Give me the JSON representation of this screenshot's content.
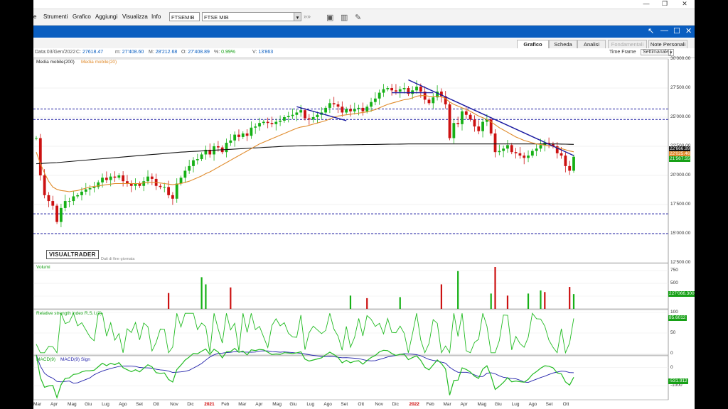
{
  "window": {
    "minimize_icon": "—",
    "restore_icon": "❐",
    "close_icon": "✕"
  },
  "menu": {
    "items": [
      "e",
      "Strumenti",
      "Grafico",
      "Aggiungi",
      "Visualizza",
      "Info"
    ]
  },
  "toolbar": {
    "symbol_code": "FTSEMIB",
    "symbol_name": "FTSE MIB",
    "go_icon": "»»"
  },
  "panel_controls": {
    "pin_icon": "↖",
    "min_icon": "—",
    "max_icon": "☐",
    "close_icon": "✕"
  },
  "tabs": [
    {
      "label": "Grafico",
      "active": true
    },
    {
      "label": "Scheda"
    },
    {
      "label": "Analisi"
    },
    {
      "label": "Fondamentali",
      "disabled": true
    },
    {
      "label": "Note Personali"
    }
  ],
  "timeframe": {
    "label": "Time Frame",
    "value": "Settimanale"
  },
  "ohlc": {
    "date_label": "Data:",
    "date": "03/Gen/2022",
    "c_label": "C:",
    "c": "27618.47",
    "m_label": "m:",
    "m": "27'408.60",
    "M_label": "M:",
    "M": "28'212.68",
    "O_label": "O:",
    "O": "27'408.89",
    "pct_label": "%:",
    "pct": "0.99%",
    "v_label": "V:",
    "v": "13'863"
  },
  "indicators": {
    "ma200": "Media mobile(200)",
    "ma20": "Media mobile(20)",
    "volume": "Volumi",
    "rsi": "Relative strength index R.S.I.(2)",
    "macd": "MACD(9)",
    "macd_sign": "MACD(9) Sign"
  },
  "brand": {
    "logo": "VISUALTRADER",
    "note": "Dati di fine giornata"
  },
  "price_axis": [
    "30'000.00",
    "27'500.00",
    "25'000.00",
    "22'500.00",
    "20'000.00",
    "17'500.00",
    "15'000.00",
    "12'500.00"
  ],
  "price_tags": {
    "ma200": "22'666.99",
    "ma20": "22'025.46",
    "last": "21'567.55"
  },
  "volume_axis": [
    "750",
    "500",
    "250"
  ],
  "volume_tag": "227'066.300",
  "rsi_axis": [
    "100",
    "50",
    "0"
  ],
  "rsi_tag": "85.6012",
  "macd_axis": [
    "0",
    "-1000"
  ],
  "macd_tag": "-531.912",
  "x_labels": [
    {
      "t": "Mar"
    },
    {
      "t": "Apr"
    },
    {
      "t": "Mag"
    },
    {
      "t": "Giu"
    },
    {
      "t": "Lug"
    },
    {
      "t": "Ago"
    },
    {
      "t": "Set"
    },
    {
      "t": "Ott"
    },
    {
      "t": "Nov"
    },
    {
      "t": "Dic"
    },
    {
      "t": "2021",
      "year": true
    },
    {
      "t": "Feb"
    },
    {
      "t": "Mar"
    },
    {
      "t": "Apr"
    },
    {
      "t": "Mag"
    },
    {
      "t": "Giu"
    },
    {
      "t": "Lug"
    },
    {
      "t": "Ago"
    },
    {
      "t": "Set"
    },
    {
      "t": "Ott"
    },
    {
      "t": "Nov"
    },
    {
      "t": "Dic"
    },
    {
      "t": "2022",
      "year": true
    },
    {
      "t": "Feb"
    },
    {
      "t": "Mar"
    },
    {
      "t": "Apr"
    },
    {
      "t": "Mag"
    },
    {
      "t": "Giu"
    },
    {
      "t": "Lug"
    },
    {
      "t": "Ago"
    },
    {
      "t": "Set"
    },
    {
      "t": "Ott"
    }
  ],
  "colors": {
    "up": "#16b016",
    "down": "#cc1111",
    "ma20": "#e08a2a",
    "ma200": "#111111",
    "hline": "#1a1aa0",
    "trend": "#1a1aa0",
    "rsi": "#22bb22",
    "macd": "#22bb22",
    "signal": "#2222aa",
    "accent": "#0a5ec0"
  },
  "chart_data": {
    "type": "candlestick",
    "frequency": "weekly",
    "ylim": [
      12500,
      30000
    ],
    "close": [
      23200,
      20000,
      18300,
      17800,
      17400,
      16000,
      17200,
      17800,
      17800,
      18200,
      18300,
      18600,
      18800,
      18900,
      19000,
      19400,
      19800,
      19600,
      19900,
      19800,
      20000,
      19500,
      19300,
      19100,
      19300,
      19100,
      19500,
      19900,
      19700,
      19100,
      19000,
      19000,
      18300,
      18000,
      19300,
      19800,
      20400,
      20800,
      21300,
      21400,
      21800,
      22200,
      21800,
      22500,
      22400,
      22000,
      22800,
      23000,
      23500,
      23300,
      23600,
      23400,
      24100,
      24200,
      24500,
      24600,
      24500,
      24400,
      24600,
      24700,
      25000,
      25100,
      25200,
      25400,
      25600,
      24900,
      24800,
      25000,
      25200,
      25400,
      25800,
      26200,
      26100,
      25900,
      25400,
      25700,
      25500,
      25700,
      25800,
      25500,
      25900,
      26300,
      26600,
      27100,
      27400,
      27500,
      27300,
      27200,
      27400,
      27500,
      27000,
      27300,
      27618,
      27200,
      26500,
      26200,
      26700,
      27200,
      26800,
      26100,
      23200,
      24500,
      24400,
      25500,
      25200,
      24800,
      24200,
      23800,
      24600,
      24800,
      23600,
      22000,
      22100,
      22300,
      22600,
      22000,
      21900,
      21700,
      21500,
      21700,
      22100,
      22300,
      22600,
      22800,
      22700,
      22500,
      21900,
      21700,
      20800,
      20400,
      21600
    ],
    "ma20": [
      22000,
      21000,
      20200,
      19500,
      19000,
      18800,
      18700,
      18650,
      18600,
      18650,
      18700,
      18800,
      18900,
      19000,
      19050,
      19100,
      19150,
      19200,
      19250,
      19300,
      19300,
      19300,
      19300,
      19300,
      19300,
      19300,
      19350,
      19400,
      19400,
      19380,
      19350,
      19300,
      19250,
      19200,
      19250,
      19300,
      19400,
      19500,
      19650,
      19800,
      19950,
      20150,
      20300,
      20500,
      20700,
      20900,
      21100,
      21300,
      21500,
      21700,
      21900,
      22100,
      22300,
      22500,
      22700,
      22850,
      23000,
      23150,
      23300,
      23450,
      23600,
      23750,
      23900,
      24050,
      24150,
      24200,
      24300,
      24400,
      24500,
      24600,
      24700,
      24850,
      25000,
      25100,
      25150,
      25200,
      25250,
      25300,
      25350,
      25400,
      25450,
      25550,
      25650,
      25800,
      25950,
      26100,
      26200,
      26300,
      26400,
      26500,
      26550,
      26650,
      26800,
      26850,
      26850,
      26800,
      26800,
      26800,
      26750,
      26600,
      26300,
      26100,
      25950,
      25800,
      25650,
      25500,
      25300,
      25100,
      24950,
      24800,
      24600,
      24350,
      24100,
      23900,
      23700,
      23500,
      23300,
      23150,
      23000,
      22900,
      22800,
      22700,
      22650,
      22600,
      22550,
      22500,
      22400,
      22300,
      22200,
      22100,
      22025
    ],
    "ma200": [
      21000,
      21020,
      21040,
      21060,
      21080,
      21100,
      21130,
      21160,
      21190,
      21220,
      21250,
      21280,
      21310,
      21340,
      21370,
      21400,
      21430,
      21460,
      21490,
      21520,
      21550,
      21580,
      21610,
      21640,
      21670,
      21700,
      21730,
      21760,
      21790,
      21820,
      21850,
      21880,
      21910,
      21940,
      21970,
      22000,
      22020,
      22040,
      22060,
      22080,
      22100,
      22120,
      22140,
      22160,
      22180,
      22200,
      22220,
      22240,
      22260,
      22280,
      22300,
      22320,
      22340,
      22360,
      22380,
      22400,
      22420,
      22440,
      22460,
      22480,
      22500,
      22510,
      22520,
      22530,
      22540,
      22550,
      22560,
      22570,
      22580,
      22590,
      22600,
      22605,
      22610,
      22615,
      22620,
      22625,
      22630,
      22635,
      22640,
      22645,
      22650,
      22655,
      22660,
      22665,
      22670,
      22675,
      22680,
      22685,
      22690,
      22695,
      22700,
      22700,
      22700,
      22700,
      22700,
      22700,
      22700,
      22700,
      22700,
      22700,
      22700,
      22700,
      22700,
      22700,
      22700,
      22700,
      22700,
      22700,
      22700,
      22700,
      22700,
      22700,
      22700,
      22700,
      22700,
      22700,
      22700,
      22700,
      22700,
      22700,
      22700,
      22700,
      22700,
      22700,
      22700,
      22700,
      22700,
      22690,
      22680,
      22670,
      22667
    ],
    "horizontal_levels": [
      25700,
      24800,
      16700,
      15000
    ],
    "trendlines": [
      {
        "from": {
          "i": 63,
          "v": 25900
        },
        "to": {
          "i": 75,
          "v": 24700
        }
      },
      {
        "from": {
          "i": 90,
          "v": 28200
        },
        "to": {
          "i": 130,
          "v": 21700
        }
      },
      {
        "from": {
          "i": 86,
          "v": 27100
        },
        "to": {
          "i": 96,
          "v": 27100
        }
      }
    ],
    "volume_spikes": [
      {
        "i": 32,
        "v": 310,
        "dir": "down"
      },
      {
        "i": 40,
        "v": 620,
        "dir": "up"
      },
      {
        "i": 41,
        "v": 480,
        "dir": "up"
      },
      {
        "i": 47,
        "v": 420,
        "dir": "down"
      },
      {
        "i": 76,
        "v": 260,
        "dir": "up"
      },
      {
        "i": 80,
        "v": 210,
        "dir": "down"
      },
      {
        "i": 88,
        "v": 230,
        "dir": "up"
      },
      {
        "i": 98,
        "v": 480,
        "dir": "down"
      },
      {
        "i": 102,
        "v": 740,
        "dir": "up"
      },
      {
        "i": 110,
        "v": 300,
        "dir": "up"
      },
      {
        "i": 111,
        "v": 820,
        "dir": "down"
      },
      {
        "i": 114,
        "v": 260,
        "dir": "down"
      },
      {
        "i": 119,
        "v": 300,
        "dir": "up"
      },
      {
        "i": 122,
        "v": 360,
        "dir": "up"
      },
      {
        "i": 123,
        "v": 330,
        "dir": "down"
      },
      {
        "i": 129,
        "v": 430,
        "dir": "down"
      },
      {
        "i": 130,
        "v": 290,
        "dir": "up"
      }
    ],
    "rsi_last": 85.6012,
    "macd_last": -531.912
  }
}
